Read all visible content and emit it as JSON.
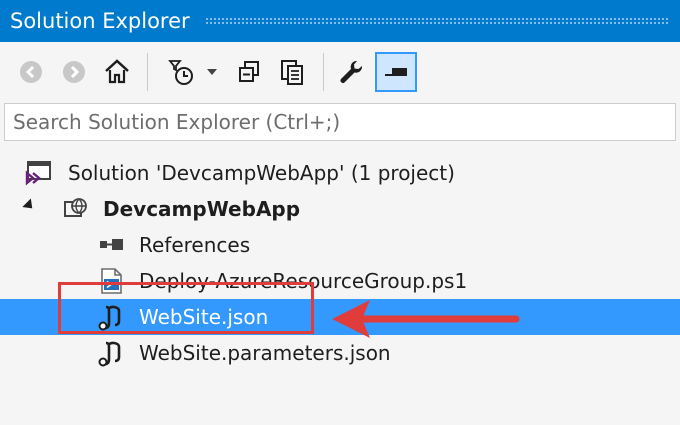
{
  "window": {
    "title": "Solution Explorer"
  },
  "toolbar": {
    "buttons": [
      {
        "name": "back-icon"
      },
      {
        "name": "forward-icon"
      },
      {
        "name": "home-icon"
      },
      {
        "name": "pending-changes-filter-icon"
      },
      {
        "name": "dropdown-arrow-icon"
      },
      {
        "name": "collapse-all-icon"
      },
      {
        "name": "show-all-files-icon"
      },
      {
        "name": "properties-wrench-icon"
      },
      {
        "name": "preview-selected-items-icon"
      }
    ]
  },
  "search": {
    "placeholder": "Search Solution Explorer (Ctrl+;)",
    "value": ""
  },
  "tree": {
    "solution": {
      "label": "Solution 'DevcampWebApp' (1 project)",
      "icon": "solution-icon"
    },
    "project": {
      "label": "DevcampWebApp",
      "icon": "web-project-icon",
      "expanded": true
    },
    "items": [
      {
        "label": "References",
        "icon": "references-icon",
        "selected": false
      },
      {
        "label": "Deploy-AzureResourceGroup.ps1",
        "icon": "powershell-script-icon",
        "selected": false
      },
      {
        "label": "WebSite.json",
        "icon": "json-template-icon",
        "selected": true
      },
      {
        "label": "WebSite.parameters.json",
        "icon": "json-template-icon",
        "selected": false
      }
    ]
  },
  "annotation": {
    "color": "#e03c3c",
    "target": "WebSite.json"
  },
  "colors": {
    "titlebar": "#007acc",
    "selection": "#3399ff",
    "background": "#f5f5f5"
  }
}
